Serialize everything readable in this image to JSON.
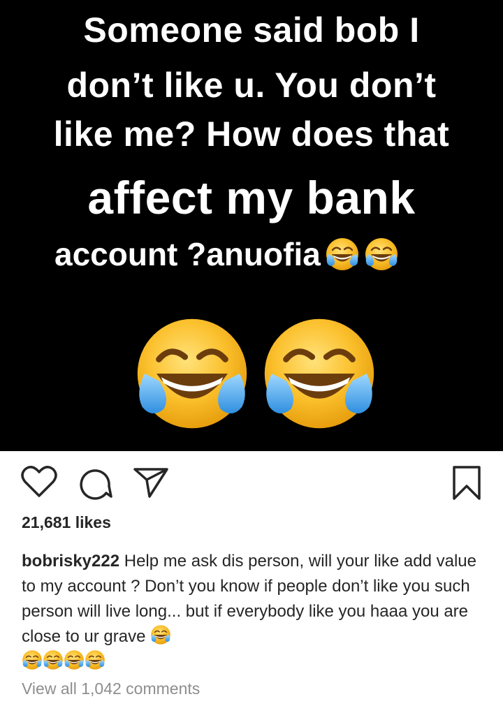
{
  "post": {
    "image": {
      "lines": [
        "Someone said bob I",
        "don’t like u. You don’t",
        "like me? How does that",
        "affect my bank",
        "account ?anuofia"
      ],
      "emoji_icon": "face-with-tears-of-joy-icon",
      "background_color": "#000000",
      "text_color": "#ffffff"
    },
    "actions": {
      "like_icon": "heart-icon",
      "comment_icon": "comment-icon",
      "share_icon": "share-icon",
      "save_icon": "bookmark-icon"
    },
    "likes": "21,681 likes",
    "caption": {
      "username": "bobrisky222",
      "text": "Help me ask dis person, will your like add value to my account ? Don’t you know if people don’t like you such person will live long... but if everybody like you haaa you are close to ur grave"
    },
    "view_all_comments": "View all 1,042 comments"
  }
}
